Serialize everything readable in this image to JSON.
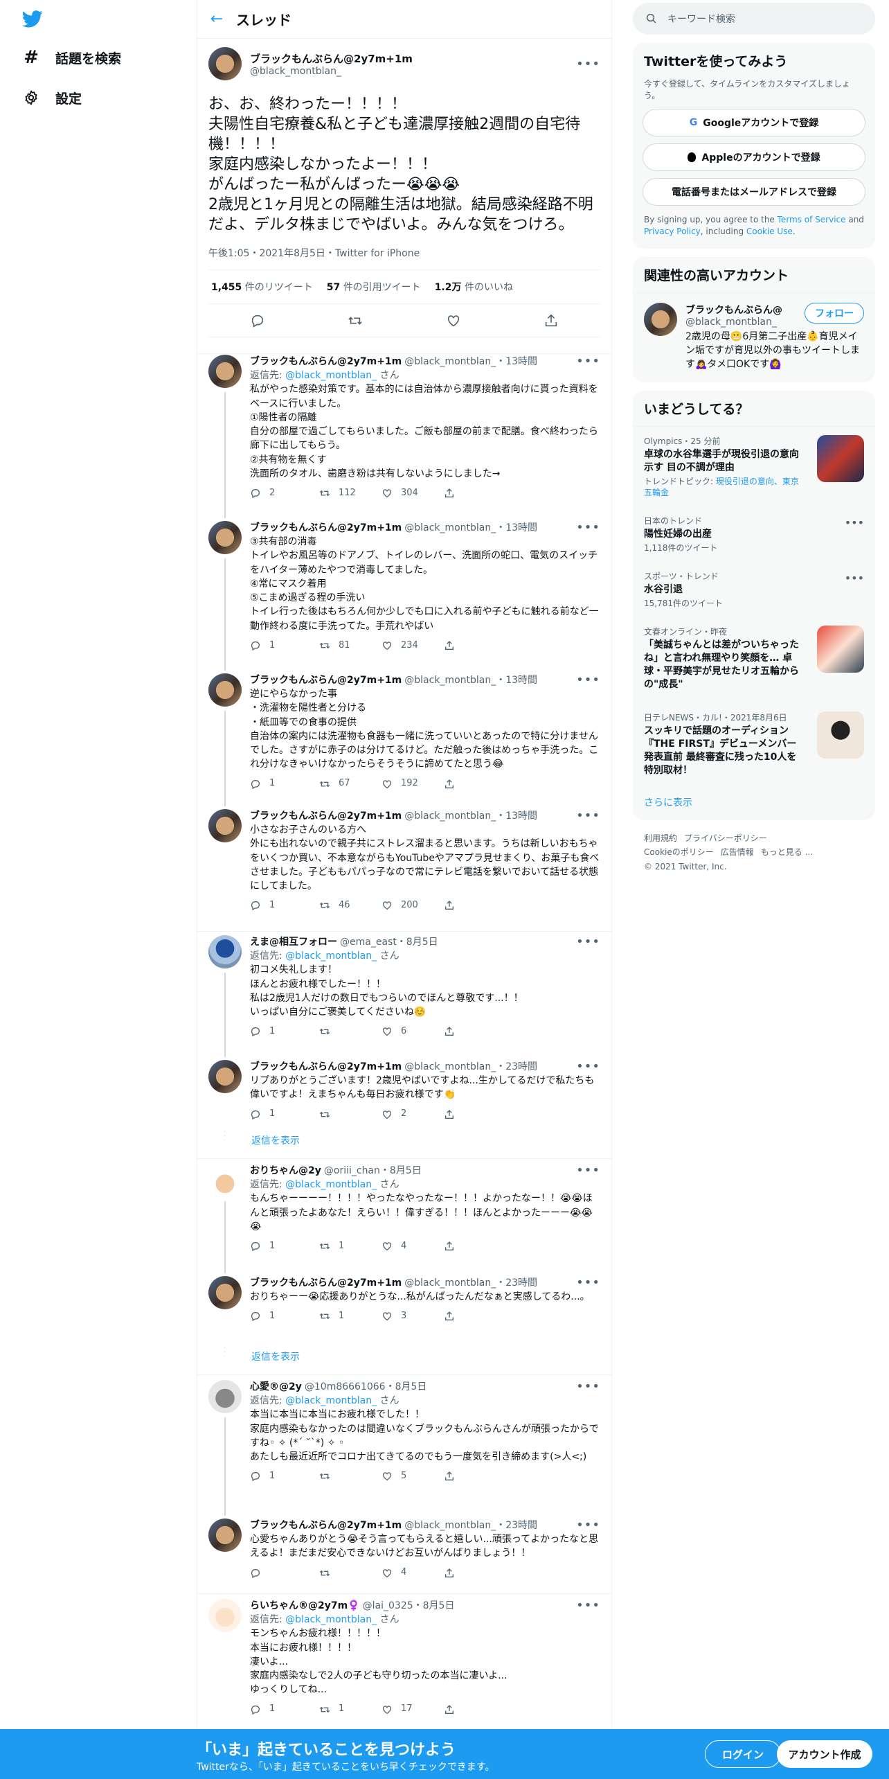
{
  "nav": {
    "explore": "話題を検索",
    "settings": "設定"
  },
  "header": {
    "title": "スレッド"
  },
  "focus": {
    "name": "ブラックもんぶらん@2y7m+1m",
    "handle": "@black_montblan_",
    "text": "お、お、終わったー！！！！\n夫陽性自宅療養&私と子ども達濃厚接触2週間の自宅待機！！！！\n家庭内感染しなかったよー！！！\nがんばったー私がんばったー😭😭😭\n2歳児と1ヶ月児との隔離生活は地獄。結局感染経路不明だよ、デルタ株まじでやばいよ。みんな気をつけろ。",
    "time": "午後1:05・2021年8月5日・Twitter for iPhone",
    "retweets": "1,455",
    "retweets_label": "件のリツイート",
    "quotes": "57",
    "quotes_label": "件の引用ツイート",
    "likes": "1.2万",
    "likes_label": "件のいいね"
  },
  "replies": [
    {
      "name": "ブラックもんぶらん@2y7m+1m",
      "sub": "@black_montblan_・13時間",
      "replyto_label": "返信先: ",
      "replyto": "@black_montblan_",
      "replyto_suffix": "さん",
      "text": "私がやった感染対策です。基本的には自治体から濃厚接触者向けに貰った資料をベースに行いました。\n①陽性者の隔離\n自分の部屋で過ごしてもらいました。ご飯も部屋の前まで配膳。食べ終わったら廊下に出してもらう。\n②共有物を無くす\n洗面所のタオル、歯磨き粉は共有しないようにしました→",
      "reply": "2",
      "rt": "112",
      "like": "304"
    },
    {
      "name": "ブラックもんぶらん@2y7m+1m",
      "sub": "@black_montblan_・13時間",
      "text": "③共有部の消毒\nトイレやお風呂等のドアノブ、トイレのレバー、洗面所の蛇口、電気のスイッチをハイター薄めたやつで消毒してました。\n④常にマスク着用\n⑤こまめ過ぎる程の手洗い\nトイレ行った後はもちろん何か少しでも口に入れる前や子どもに触れる前など一動作終わる度に手洗ってた。手荒れやばい",
      "reply": "1",
      "rt": "81",
      "like": "234"
    },
    {
      "name": "ブラックもんぶらん@2y7m+1m",
      "sub": "@black_montblan_・13時間",
      "text": "逆にやらなかった事\n・洗濯物を陽性者と分ける\n・紙皿等での食事の提供\n自治体の案内には洗濯物も食器も一緒に洗っていいとあったので特に分けませんでした。さすがに赤子のは分けてるけど。ただ触った後はめっちゃ手洗った。これ分けなきゃいけなかったらそうそうに諦めてたと思う😂",
      "reply": "1",
      "rt": "67",
      "like": "192"
    },
    {
      "name": "ブラックもんぶらん@2y7m+1m",
      "sub": "@black_montblan_・13時間",
      "text": "小さなお子さんのいる方へ\n外にも出れないので親子共にストレス溜まると思います。うちは新しいおもちゃをいくつか買い、不本意ながらもYouTubeやアマプラ見せまくり、お菓子も食べさせました。子どももパパっ子なので常にテレビ電話を繋いでおいて話せる状態にしてました。",
      "reply": "1",
      "rt": "46",
      "like": "200"
    },
    {
      "name": "えま@相互フォロー",
      "sub": "@ema_east・8月5日",
      "replyto_label": "返信先: ",
      "replyto": "@black_montblan_",
      "replyto_suffix": "さん",
      "text": "初コメ失礼します！\nほんとお疲れ様でしたー！！！\n私は2歳児1人だけの数日でもつらいのでほんと尊敬です...！！\nいっぱい自分にご褒美してくださいね☺️",
      "reply": "1",
      "rt": "",
      "like": "6"
    },
    {
      "name": "ブラックもんぶらん@2y7m+1m",
      "sub": "@black_montblan_・23時間",
      "text": "リプありがとうございます！2歳児やばいですよね...生かしてるだけで私たちも偉いですよ！えまちゃんも毎日お疲れ様です👏",
      "reply": "1",
      "rt": "",
      "like": "2"
    },
    {
      "name": "おりちゃん@2y",
      "sub": "@oriii_chan・8月5日",
      "replyto_label": "返信先: ",
      "replyto": "@black_montblan_",
      "replyto_suffix": "さん",
      "text": "もんちゃーーーー！！！！やったなやったなー！！！よかったなー！！😭😭ほんと頑張ったよあなた！えらい！！偉すぎる！！！ほんとよかったーーー😭😭😭",
      "reply": "1",
      "rt": "1",
      "like": "4"
    },
    {
      "name": "ブラックもんぶらん@2y7m+1m",
      "sub": "@black_montblan_・23時間",
      "text": "おりちゃーー😭応援ありがとうな...私がんばったんだなぁと実感してるわ...。",
      "reply": "1",
      "rt": "1",
      "like": "3"
    },
    {
      "name": "心愛®@2y",
      "sub": "@10m86661066・8月5日",
      "replyto_label": "返信先: ",
      "replyto": "@black_montblan_",
      "replyto_suffix": "さん",
      "text": "本当に本当に本当にお疲れ様でした！！\n家庭内感染もなかったのは間違いなくブラックもんぶらんさんが頑張ったからですね◦ ✧ (*´ ˘`*) ✧ ◦\nあたしも最近近所でコロナ出てきてるのでもう一度気を引き締めます(>人<;)",
      "reply": "1",
      "rt": "",
      "like": "5"
    },
    {
      "name": "ブラックもんぶらん@2y7m+1m",
      "sub": "@black_montblan_・23時間",
      "text": "心愛ちゃんありがとう😭そう言ってもらえると嬉しい...頑張ってよかったなと思えるよ！まだまだ安心できないけどお互いがんばりましょう！！",
      "reply": "",
      "rt": "",
      "like": "4"
    },
    {
      "name": "らいちゃん®@2y7m♀️",
      "sub": "@lai_0325・8月5日",
      "replyto_label": "返信先: ",
      "replyto": "@black_montblan_",
      "replyto_suffix": "さん",
      "text": "モンちゃんお疲れ様！！！！！\n本当にお疲れ様！！！！\n凄いよ...\n家庭内感染なしで2人の子ども守り切ったの本当に凄いよ...\nゆっくりしてね...",
      "reply": "1",
      "rt": "1",
      "like": "17"
    }
  ],
  "show_replies": "返信を表示",
  "right": {
    "search_placeholder": "キーワード検索",
    "signup_title": "Twitterを使ってみよう",
    "signup_sub": "今すぐ登録して、タイムラインをカスタマイズしましょう。",
    "google": "Googleアカウントで登録",
    "apple": "Appleのアカウントで登録",
    "phone": "電話番号またはメールアドレスで登録",
    "terms_pre": "By signing up, you agree to the ",
    "terms_tos": "Terms of Service",
    "terms_and": " and ",
    "terms_pp": "Privacy Policy",
    "terms_inc": ", including ",
    "terms_cookie": "Cookie Use",
    "terms_end": ".",
    "related_title": "関連性の高いアカウント",
    "rel_name": "ブラックもんぶらん@",
    "rel_handle": "@black_montblan_",
    "rel_bio": "2歳児の母😬6月第二子出産👶育児メイン垢ですが育児以外の事もツイートします🙇‍♀️タメ口OKです🙆‍♀️",
    "follow": "フォロー",
    "trends_title": "いまどうしてる？",
    "t1_meta": "Olympics・25 分前",
    "t1_title": "卓球の水谷隼選手が現役引退の意向示す 目の不調が理由",
    "t1_extra_label": "トレンドトピック: ",
    "t1_extra": "現役引退の意向、東京五輪金",
    "t2_meta": "日本のトレンド",
    "t2_title": "陽性妊婦の出産",
    "t2_count": "1,118件のツイート",
    "t3_meta": "スポーツ・トレンド",
    "t3_title": "水谷引退",
    "t3_count": "15,781件のツイート",
    "t4_meta": "文春オンライン・昨夜",
    "t4_title": "「美誠ちゃんとは差がついちゃったね」と言われ無理やり笑顔を… 卓球・平野美宇が見せたリオ五輪からの\"成長\"",
    "t5_meta": "日テレNEWS・カル!・2021年8月6日",
    "t5_title": "スッキリで話題のオーディション『THE FIRST』デビューメンバー発表直前 最終審査に残った10人を特別取材！",
    "show_more": "さらに表示",
    "footer": [
      "利用規約",
      "プライバシーポリシー",
      "Cookieのポリシー",
      "広告情報",
      "もっと見る ..."
    ],
    "copyright": "© 2021 Twitter, Inc."
  },
  "banner": {
    "title": "「いま」起きていることを見つけよう",
    "sub": "Twitterなら、「いま」起きていることをいち早くチェックできます。",
    "login": "ログイン",
    "signup": "アカウント作成"
  },
  "colors": {
    "accent": "#1d9bf0",
    "text": "#0f1419",
    "muted": "#536471"
  }
}
